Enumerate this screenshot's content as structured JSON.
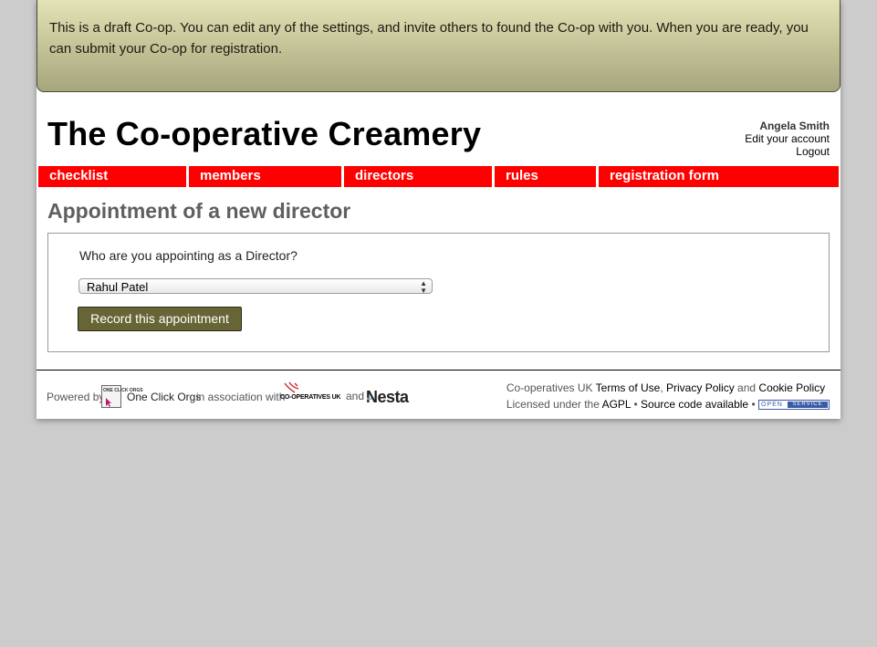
{
  "notice": {
    "text": "This is a draft Co-op. You can edit any of the settings, and invite others to found the Co-op with you. When you are ready, you can submit your Co-op for registration."
  },
  "header": {
    "title": "The Co-operative Creamery",
    "user_name": "Angela Smith",
    "edit_account": "Edit your account",
    "logout": "Logout"
  },
  "nav": {
    "tabs": [
      {
        "label": "checklist"
      },
      {
        "label": "members"
      },
      {
        "label": "directors"
      },
      {
        "label": "rules"
      },
      {
        "label": "registration form"
      }
    ]
  },
  "main": {
    "heading": "Appointment of a new director",
    "question": "Who are you appointing as a Director?",
    "selected_person": "Rahul Patel",
    "submit_label": "Record this appointment"
  },
  "footer": {
    "powered_by": "Powered by",
    "oco_logo_text": "ONE CLICK ORGS",
    "one_click_orgs": "One Click Orgs",
    "association": "in association with",
    "coops_uk_logo": "CO-OPERATIVES UK",
    "and": "and",
    "nesta": "Nesta",
    "coops_uk_prefix": "Co-operatives UK",
    "terms": "Terms of Use",
    "privacy": "Privacy Policy",
    "and2": "and",
    "cookie": "Cookie Policy",
    "licensed": "Licensed under the",
    "agpl": "AGPL",
    "bullet": "•",
    "source": "Source code available",
    "badge_left": "OPEN",
    "badge_right": "SERVICE"
  },
  "colors": {
    "nav_red": "#ff0000",
    "button_olive": "#676536",
    "page_bg": "#cccccc"
  }
}
